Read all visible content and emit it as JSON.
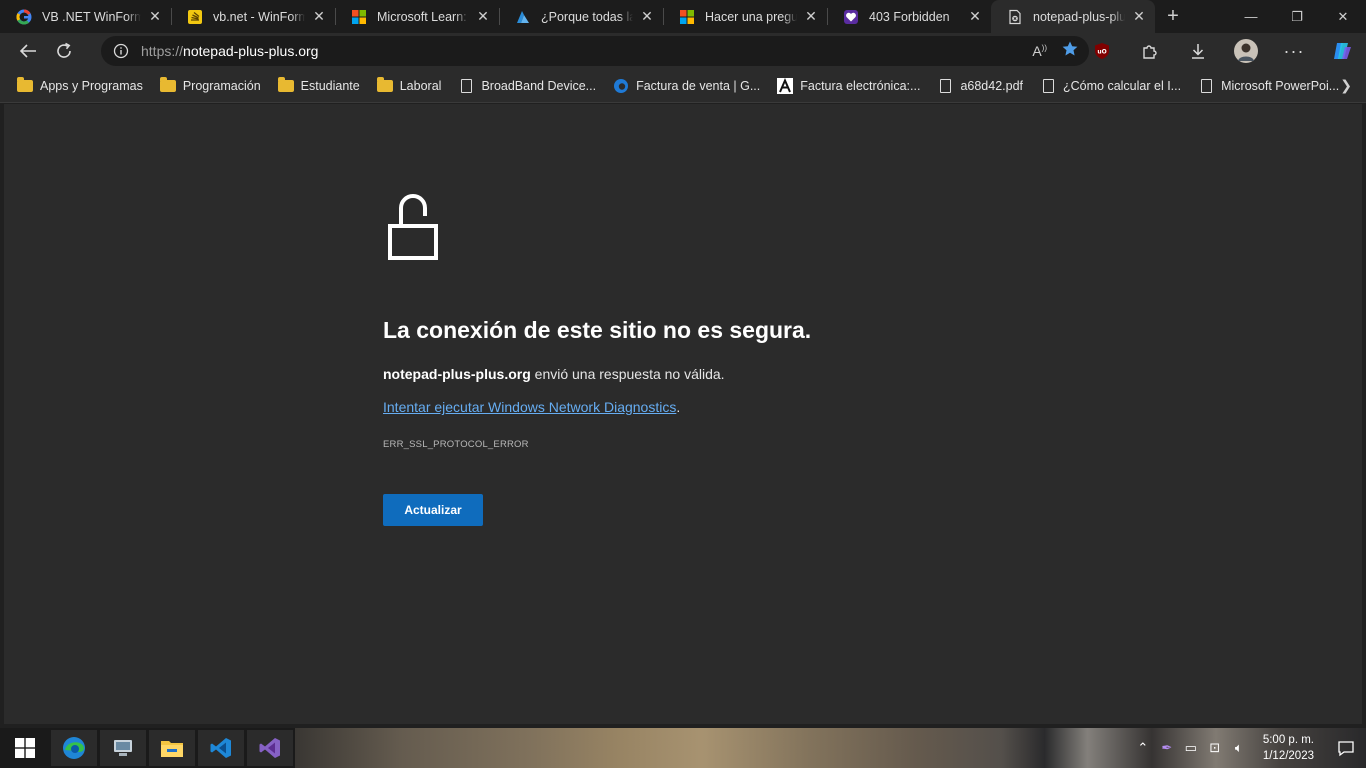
{
  "tabs": [
    {
      "title": "VB .NET WinForms",
      "icon": "google-icon"
    },
    {
      "title": "vb.net - WinForms",
      "icon": "stackoverflow-icon"
    },
    {
      "title": "Microsoft Learn: de",
      "icon": "microsoft-icon"
    },
    {
      "title": "¿Porque todas las p",
      "icon": "azure-icon"
    },
    {
      "title": "Hacer una pregunta",
      "icon": "microsoft-icon"
    },
    {
      "title": "403 Forbidden",
      "icon": "heart-shield-icon"
    },
    {
      "title": "notepad-plus-plus",
      "icon": "page-error-icon"
    }
  ],
  "address": {
    "scheme": "https://",
    "host": "notepad-plus-plus.org"
  },
  "bookmarks": [
    {
      "label": "Apps y Programas",
      "type": "folder"
    },
    {
      "label": "Programación",
      "type": "folder"
    },
    {
      "label": "Estudiante",
      "type": "folder"
    },
    {
      "label": "Laboral",
      "type": "folder"
    },
    {
      "label": "BroadBand Device...",
      "type": "doc"
    },
    {
      "label": "Factura de venta | G...",
      "type": "edge"
    },
    {
      "label": "Factura electrónica:...",
      "type": "a"
    },
    {
      "label": "a68d42.pdf",
      "type": "doc"
    },
    {
      "label": "¿Cómo calcular el I...",
      "type": "doc"
    },
    {
      "label": "Microsoft PowerPoi...",
      "type": "doc"
    }
  ],
  "error": {
    "headline": "La conexión de este sitio no es segura.",
    "host": "notepad-plus-plus.org",
    "message": " envió una respuesta no válida.",
    "diagnostics_link": "Intentar ejecutar Windows Network Diagnostics",
    "diagnostics_suffix": ".",
    "code": "ERR_SSL_PROTOCOL_ERROR",
    "reload_label": "Actualizar"
  },
  "taskbar": {
    "time": "5:00 p. m.",
    "date": "1/12/2023"
  },
  "colors": {
    "accent": "#0f6cbd",
    "link": "#66adf2",
    "background": "#2b2b2b"
  }
}
